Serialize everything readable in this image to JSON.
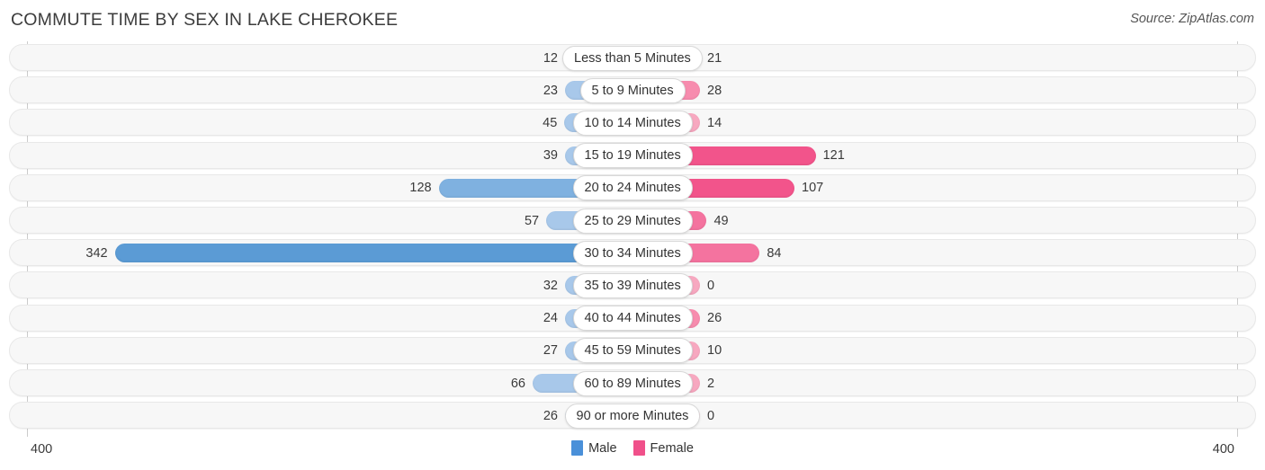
{
  "header": {
    "title": "COMMUTE TIME BY SEX IN LAKE CHEROKEE",
    "source": "Source: ZipAtlas.com"
  },
  "legend": {
    "male_label": "Male",
    "female_label": "Female",
    "male_color": "#4a90d9",
    "female_color": "#f0508a"
  },
  "axis": {
    "left_label": "400",
    "right_label": "400",
    "max": 400
  },
  "chart_data": {
    "type": "bar",
    "orientation": "horizontal-diverging",
    "title": "COMMUTE TIME BY SEX IN LAKE CHEROKEE",
    "xlabel": "",
    "ylabel": "",
    "xlim": [
      400,
      400
    ],
    "grid": false,
    "legend_position": "bottom-center",
    "categories": [
      "Less than 5 Minutes",
      "5 to 9 Minutes",
      "10 to 14 Minutes",
      "15 to 19 Minutes",
      "20 to 24 Minutes",
      "25 to 29 Minutes",
      "30 to 34 Minutes",
      "35 to 39 Minutes",
      "40 to 44 Minutes",
      "45 to 59 Minutes",
      "60 to 89 Minutes",
      "90 or more Minutes"
    ],
    "series": [
      {
        "name": "Male",
        "values": [
          12,
          23,
          45,
          39,
          128,
          57,
          342,
          32,
          24,
          27,
          66,
          26
        ]
      },
      {
        "name": "Female",
        "values": [
          21,
          28,
          14,
          121,
          107,
          49,
          84,
          0,
          26,
          10,
          2,
          0
        ]
      }
    ]
  },
  "rows": [
    {
      "category": "Less than 5 Minutes",
      "male": 12,
      "female": 21,
      "male_text": "12",
      "female_text": "21"
    },
    {
      "category": "5 to 9 Minutes",
      "male": 23,
      "female": 28,
      "male_text": "23",
      "female_text": "28"
    },
    {
      "category": "10 to 14 Minutes",
      "male": 45,
      "female": 14,
      "male_text": "45",
      "female_text": "14"
    },
    {
      "category": "15 to 19 Minutes",
      "male": 39,
      "female": 121,
      "male_text": "39",
      "female_text": "121"
    },
    {
      "category": "20 to 24 Minutes",
      "male": 128,
      "female": 107,
      "male_text": "128",
      "female_text": "107"
    },
    {
      "category": "25 to 29 Minutes",
      "male": 57,
      "female": 49,
      "male_text": "57",
      "female_text": "49"
    },
    {
      "category": "30 to 34 Minutes",
      "male": 342,
      "female": 84,
      "male_text": "342",
      "female_text": "84"
    },
    {
      "category": "35 to 39 Minutes",
      "male": 32,
      "female": 0,
      "male_text": "32",
      "female_text": "0"
    },
    {
      "category": "40 to 44 Minutes",
      "male": 24,
      "female": 26,
      "male_text": "24",
      "female_text": "26"
    },
    {
      "category": "45 to 59 Minutes",
      "male": 27,
      "female": 10,
      "male_text": "27",
      "female_text": "10"
    },
    {
      "category": "60 to 89 Minutes",
      "male": 66,
      "female": 2,
      "male_text": "66",
      "female_text": "2"
    },
    {
      "category": "90 or more Minutes",
      "male": 26,
      "female": 0,
      "male_text": "26",
      "female_text": "0"
    }
  ]
}
